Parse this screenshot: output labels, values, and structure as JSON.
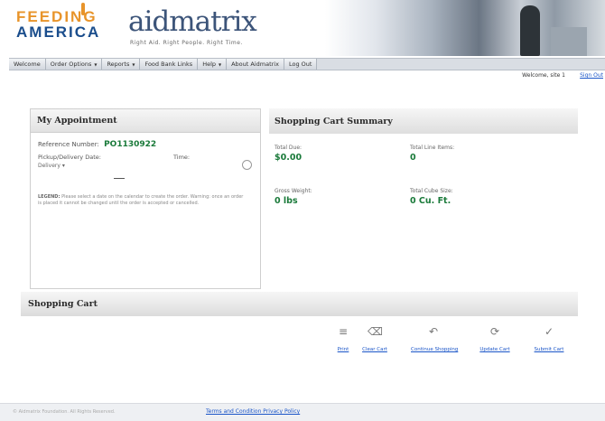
{
  "header": {
    "brand_line1": "FEEDING",
    "brand_line2": "AMERICA",
    "partner_logo": "aidmatrix",
    "partner_tagline": "Right Aid. Right People. Right Time."
  },
  "nav": {
    "items": [
      {
        "label": "Welcome",
        "arrow": false
      },
      {
        "label": "Order Options",
        "arrow": true
      },
      {
        "label": "Reports",
        "arrow": true
      },
      {
        "label": "Food Bank Links",
        "arrow": false
      },
      {
        "label": "Help",
        "arrow": true
      },
      {
        "label": "About Aidmatrix",
        "arrow": false
      },
      {
        "label": "Log Out",
        "arrow": false
      }
    ],
    "welcome_text": "Welcome, site 1",
    "signout_label": "Sign Out"
  },
  "appointment": {
    "title": "My Appointment",
    "reference_label": "Reference Number:",
    "reference_value": "PO1130922",
    "pickup_label": "Pickup/Delivery Date:",
    "time_label": "Time:",
    "delivery_value": "Delivery",
    "note_label": "LEGEND:",
    "note_text": "Please select a date on the calendar to create the order. Warning: once an order is placed it cannot be changed until the order is accepted or cancelled."
  },
  "summary": {
    "title": "Shopping Cart Summary",
    "total_due_label": "Total Due:",
    "total_due_value": "$0.00",
    "total_line_items_label": "Total Line Items:",
    "total_line_items_value": "0",
    "gross_weight_label": "Gross Weight:",
    "gross_weight_value": "0 lbs",
    "total_cube_label": "Total Cube Size:",
    "total_cube_value": "0 Cu. Ft."
  },
  "cart": {
    "title": "Shopping Cart",
    "actions": [
      {
        "label": "Print",
        "icon": "print-icon",
        "glyph": "≡"
      },
      {
        "label": "Clear Cart",
        "icon": "clear-cart-icon",
        "glyph": "⌫"
      },
      {
        "label": "Continue Shopping",
        "icon": "continue-shopping-icon",
        "glyph": "↶"
      },
      {
        "label": "Update Cart",
        "icon": "update-cart-icon",
        "glyph": "⟳"
      },
      {
        "label": "Submit Cart",
        "icon": "submit-cart-icon",
        "glyph": "✓"
      }
    ]
  },
  "footer": {
    "copyright": "© Aidmatrix Foundation. All Rights Reserved.",
    "terms_link": "Terms and Condition Privacy Policy"
  },
  "colors": {
    "brand_orange": "#e8942a",
    "brand_blue": "#1a4d8c",
    "value_green": "#1a7a3a",
    "link_blue": "#1a55c8"
  }
}
